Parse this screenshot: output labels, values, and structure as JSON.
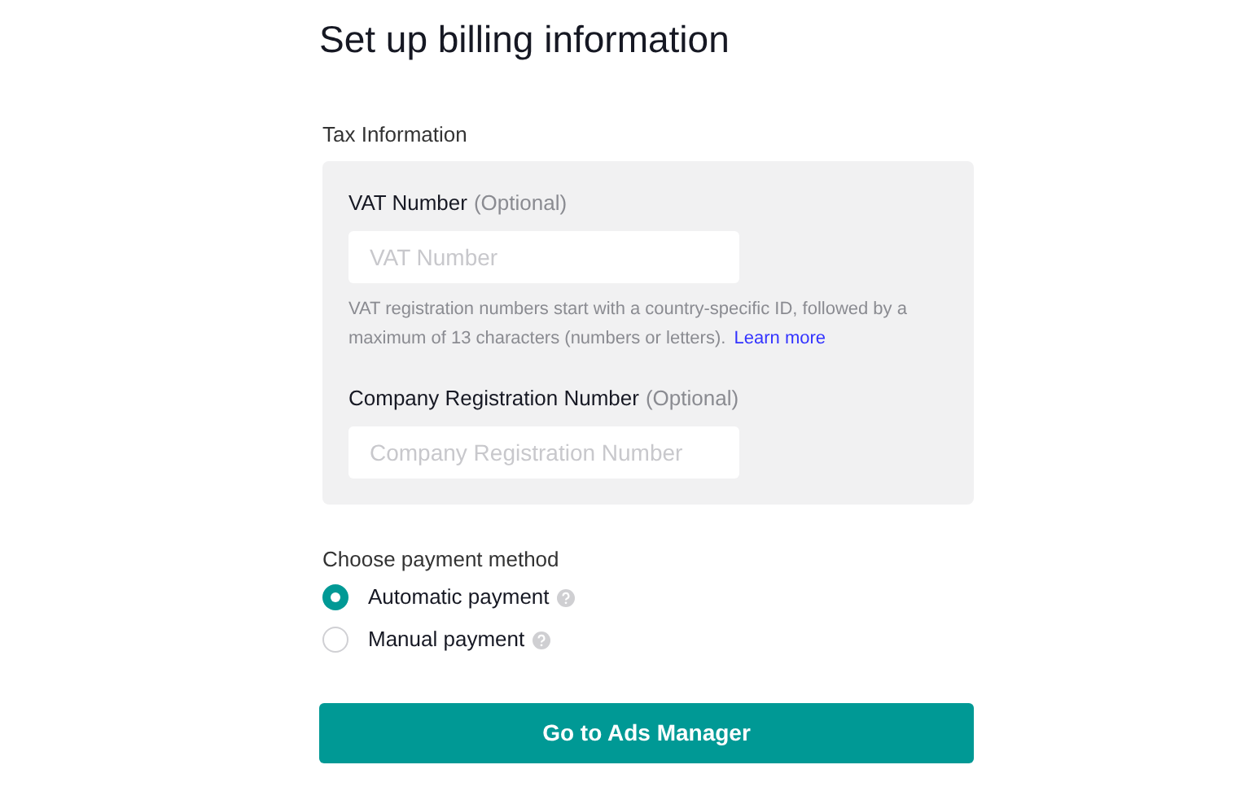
{
  "title": "Set up billing information",
  "tax_section": {
    "heading": "Tax Information",
    "fields": [
      {
        "label": "VAT Number",
        "optional": "(Optional)",
        "placeholder": "VAT Number",
        "help": "VAT registration numbers start with a country-specific ID, followed by a maximum of 13 characters (numbers or letters).",
        "help_link": "Learn more"
      },
      {
        "label": "Company Registration Number",
        "optional": "(Optional)",
        "placeholder": "Company Registration Number"
      }
    ]
  },
  "payment": {
    "heading": "Choose payment method",
    "options": [
      {
        "label": "Automatic payment",
        "selected": true
      },
      {
        "label": "Manual payment",
        "selected": false
      }
    ]
  },
  "button": "Go to Ads Manager"
}
